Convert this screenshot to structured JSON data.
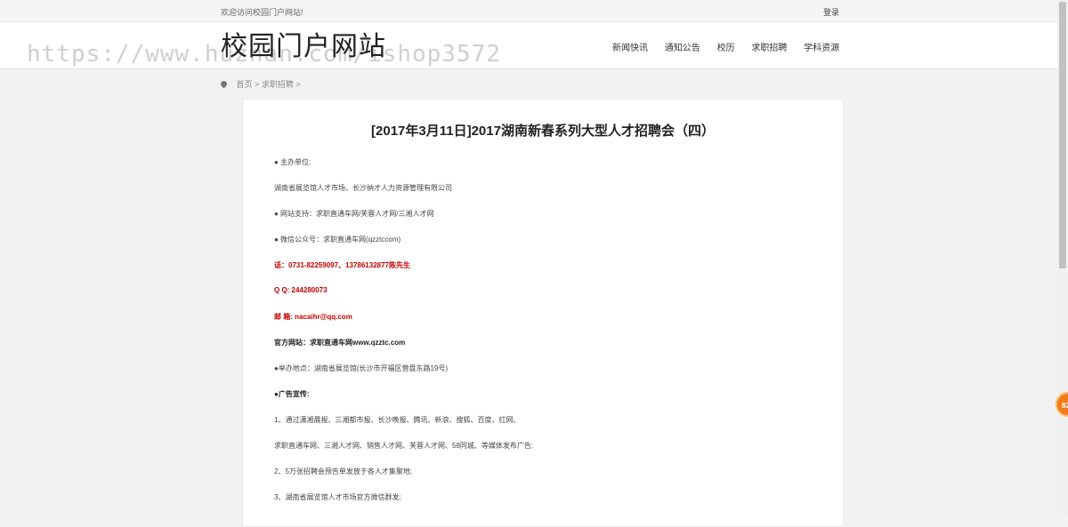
{
  "topbar": {
    "welcome": "欢迎访问校园门户网站!",
    "login": "登录"
  },
  "header": {
    "site_title": "校园门户网站",
    "watermark": "https://www.huzhan.com/ishop3572",
    "nav": [
      "新闻快讯",
      "通知公告",
      "校历",
      "求职招聘",
      "学科资源"
    ]
  },
  "breadcrumb": {
    "home": "首页",
    "sep1": ">",
    "section": "求职招聘",
    "sep2": ">"
  },
  "article": {
    "title": "[2017年3月11日]2017湖南新春系列大型人才招聘会（四）",
    "paragraphs": [
      "● 主办单位:",
      "湖南省展览馆人才市场、长沙纳才人力资源管理有限公司",
      "● 网站支持：求职直通车网/芙蓉人才网/三湘人才网",
      "● 微信公众号：求职直通车网(qzztccom)",
      "话：0731-82259097、13786132877陈先生",
      "Q Q: 244280073",
      "邮 箱: nacaihr@qq.com",
      "官方网站：求职直通车网www.qzztc.com",
      "●举办地点：湖南省展览馆(长沙市开福区营盘东路19号)",
      "●广告宣传:",
      "1、通过潇湘晨报、三湘都市报、长沙晚报、腾讯、新浪、搜狐、百度、红网、",
      "求职直通车网、三湘人才网、销售人才网、芙蓉人才网、58同城、等媒体发布广告;",
      "2、5万张招聘会预告单发放于各人才集聚地;",
      "3、湖南省展览馆人才市场官方微信群发;"
    ]
  },
  "float_badge": {
    "text": "82"
  }
}
